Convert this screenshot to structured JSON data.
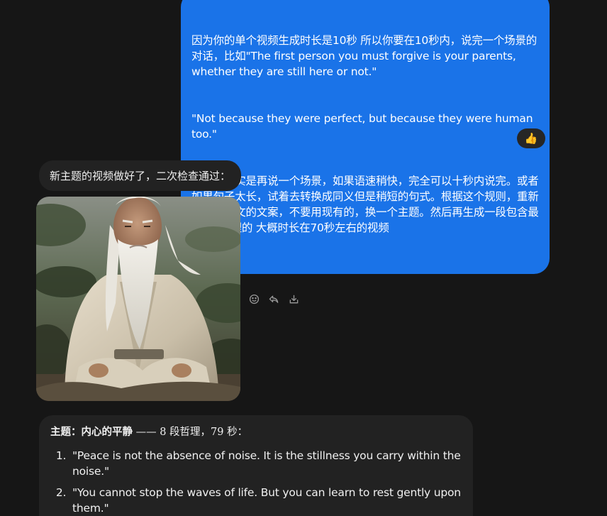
{
  "user_message": {
    "lines": [
      "因为你的单个视频生成时长是10秒 所以你要在10秒内，说完一个场景的对话，比如\"The first person you must forgive is your parents, whether they are still here or not.\"",
      "\"Not because they were perfect, but because they were human too.\"",
      "这两句其实是再说一个场景，如果语速稍快，完全可以十秒内说完。或者如果句子太长，试着去转换成同义但是稍短的句式。根据这个规则，重新写一篇英文的文案，不要用现有的，换一个主题。然后再生成一段包含最少7段哲理的 大概时长在70秒左右的视频"
    ],
    "reaction": "👍"
  },
  "assistant": {
    "status_text": "新主题的视频做好了，二次检查通过：",
    "image_icon": "elder-sage-portrait",
    "actions": [
      {
        "icon": "smile-icon"
      },
      {
        "icon": "reply-icon"
      },
      {
        "icon": "download-icon"
      }
    ],
    "answer": {
      "title_bold": "主题：内心的平静",
      "title_rest": " —— 8 段哲理，79 秒：",
      "items": [
        "\"Peace is not the absence of noise. It is the stillness you carry within the noise.\"",
        "\"You cannot stop the waves of life. But you can learn to rest gently upon them.\""
      ]
    }
  }
}
